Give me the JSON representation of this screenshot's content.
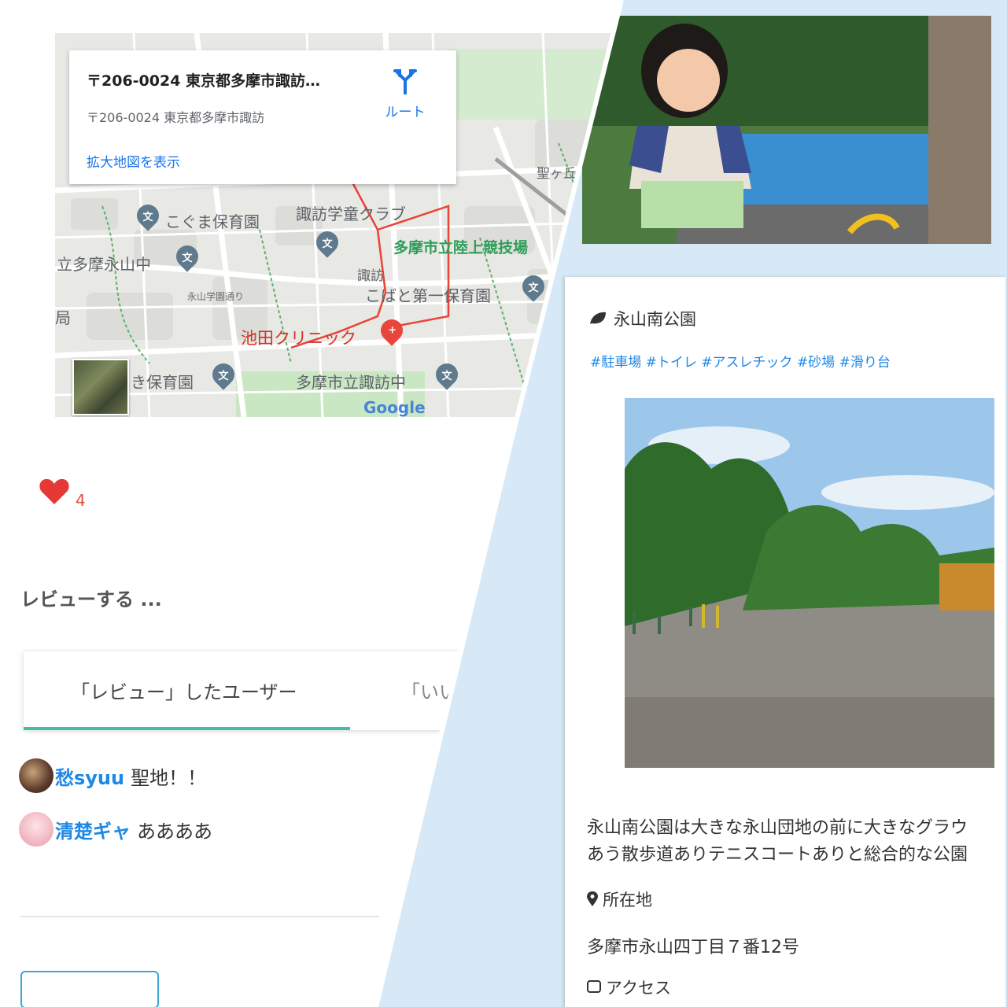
{
  "map": {
    "card_title": "〒206-0024 東京都多摩市諏訪…",
    "card_subtitle": "〒206-0024 東京都多摩市諏訪",
    "route_label": "ルート",
    "enlarge_link": "拡大地図を表示",
    "labels": {
      "kogumahoikuen": "こぐま保育園",
      "suwagakudou": "諏訪学童クラブ",
      "tamarikujou": "多摩市立陸上競技場",
      "nagayamachuu": "立多摩永山中",
      "nagayamagakuen": "永山学園通り",
      "suwa": "諏訪",
      "kobato": "こばと第一保育園",
      "ikeda": "池田クリニック",
      "kihoikuen": "き保育園",
      "suwachuu": "多摩市立諏訪中",
      "hijirigaoka": "聖ヶ丘",
      "kyoku": "局",
      "google": "Google"
    }
  },
  "likes": {
    "count": "4"
  },
  "review": {
    "heading": "レビューする ...",
    "tabs": [
      "「レビュー」したユーザー",
      "「いい"
    ],
    "items": [
      {
        "user": "愁syuu",
        "text": "聖地！！"
      },
      {
        "user": "清楚ギャ",
        "text": "ああああ"
      }
    ]
  },
  "park": {
    "name": "永山南公園",
    "tags": "#駐車場 #トイレ #アスレチック #砂場 #滑り台",
    "description": [
      "永山南公園は大きな永山団地の前に大きなグラウ",
      "あう散歩道ありテニスコートありと総合的な公園"
    ],
    "location_label": "所在地",
    "address": "多摩市永山四丁目７番12号",
    "access_label": "アクセス"
  },
  "colors": {
    "accent_blue": "#1a73e8",
    "heart_red": "#e74c3c",
    "tab_underline": "#3bbfa8",
    "right_bg": "#d7e9f6"
  }
}
